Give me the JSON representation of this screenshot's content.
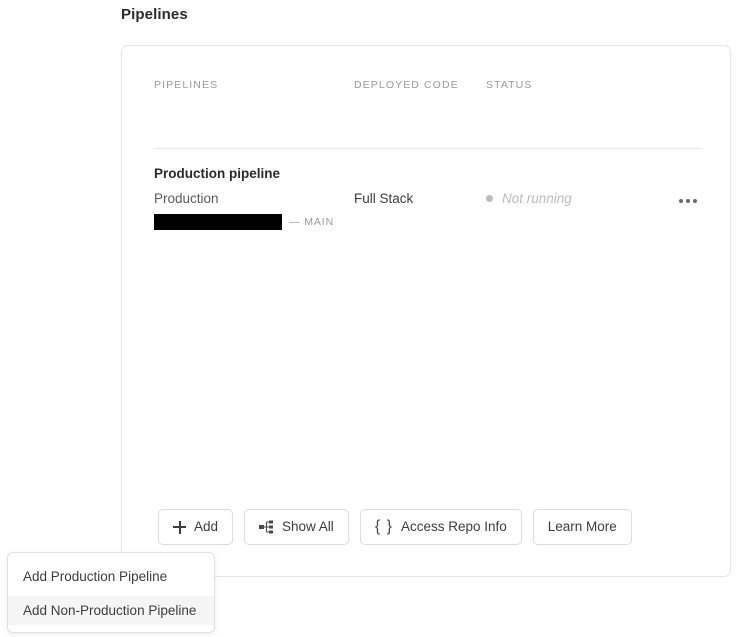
{
  "page": {
    "title": "Pipelines"
  },
  "table": {
    "columns": [
      {
        "key": "pipelines",
        "label": "PIPELINES"
      },
      {
        "key": "deployed_code",
        "label": "DEPLOYED CODE"
      },
      {
        "key": "status",
        "label": "STATUS"
      }
    ],
    "rows": [
      {
        "name": "Production pipeline",
        "environment": "Production",
        "deployed_code": "Full Stack",
        "status": "Not running",
        "status_dot_color": "#bdbdbd",
        "repo_redacted": "",
        "branch": "— MAIN",
        "overflow_menu": "more-options"
      }
    ]
  },
  "toolbar": {
    "buttons": [
      {
        "id": "add",
        "label": "Add",
        "icon": "plus-icon"
      },
      {
        "id": "show-all",
        "label": "Show All",
        "icon": "sitemap-icon"
      },
      {
        "id": "access-repo-info",
        "label": "Access Repo Info",
        "icon": "curly-braces-icon",
        "icon_glyph": "{ }"
      },
      {
        "id": "learn-more",
        "label": "Learn More",
        "icon": ""
      }
    ]
  },
  "add_menu": {
    "items": [
      {
        "label": "Add Production Pipeline",
        "hovered": false
      },
      {
        "label": "Add Non-Production Pipeline",
        "hovered": true
      }
    ]
  },
  "colors": {
    "card_border": "#e6e6e6",
    "divider": "#e8e8e8",
    "muted_text": "#9b9b9b",
    "body_text": "#3d3d3d",
    "status_muted": "#bcbcbc",
    "menu_hover": "#f5f5f5"
  }
}
